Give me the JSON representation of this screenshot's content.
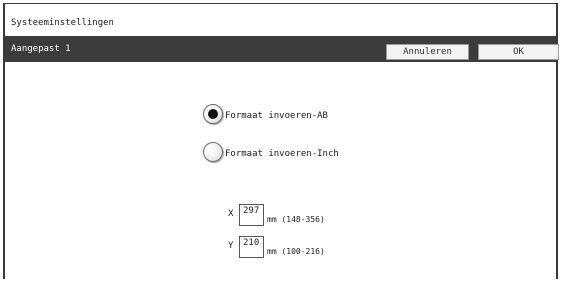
{
  "window": {
    "title": "Systeeminstellingen"
  },
  "subheader": {
    "label": "Aangepast 1",
    "cancel_label": "Annuleren",
    "ok_label": "OK"
  },
  "options": [
    {
      "label": "Formaat invoeren-AB",
      "selected": true
    },
    {
      "label": "Formaat invoeren-Inch",
      "selected": false
    }
  ],
  "fields": {
    "x": {
      "axis": "X",
      "value": "297",
      "range": "mm (148-356)"
    },
    "y": {
      "axis": "Y",
      "value": "210",
      "range": "mm (100-216)"
    }
  },
  "colors": {
    "subbar_bg": "#3c3c3c",
    "subbar_text": "#ffffff",
    "button_bg": "#f3f3f3",
    "radio_dot": "#111111"
  }
}
